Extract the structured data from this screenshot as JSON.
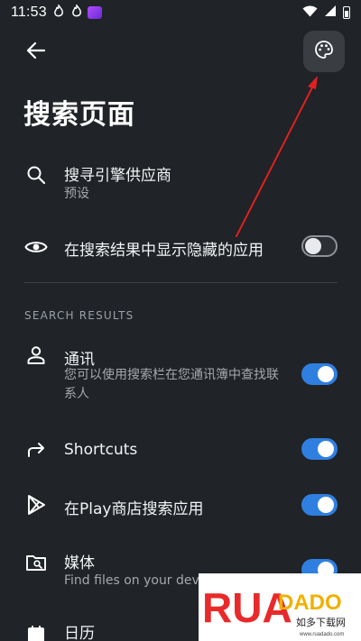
{
  "status_bar": {
    "time": "11:53",
    "notif_icons": [
      "flame-icon",
      "flame-icon",
      "app-icon"
    ],
    "system_icons": [
      "wifi-icon",
      "signal-icon",
      "battery-icon"
    ]
  },
  "header": {
    "back_icon": "back-arrow-icon",
    "palette_icon": "palette-icon"
  },
  "page": {
    "title": "搜索页面"
  },
  "items": {
    "search_engine": {
      "title": "搜寻引擎供应商",
      "subtitle": "预设",
      "icon": "search-icon"
    },
    "show_hidden": {
      "title": "在搜索结果中显示隐藏的应用",
      "icon": "eye-icon",
      "enabled": false
    }
  },
  "section": {
    "header": "SEARCH RESULTS"
  },
  "results": {
    "contacts": {
      "title": "通讯",
      "subtitle": "您可以使用搜索栏在您通讯簿中查找联系人",
      "icon": "person-icon",
      "enabled": true
    },
    "shortcuts": {
      "title": "Shortcuts",
      "icon": "share-arrow-icon",
      "enabled": true
    },
    "play_store": {
      "title": "在Play商店搜索应用",
      "icon": "play-store-icon",
      "enabled": true
    },
    "media": {
      "title": "媒体",
      "subtitle": "Find files on your dev",
      "icon": "folder-search-icon",
      "enabled": true
    },
    "calendar": {
      "title": "日历",
      "icon": "calendar-icon"
    }
  },
  "watermark": {
    "brand": "RUANDADO",
    "tagline": "如多下载网",
    "url": "www.ruadado.com"
  },
  "colors": {
    "background": "#202327",
    "accent": "#2f7fe0",
    "annotation_arrow": "#e02020"
  }
}
